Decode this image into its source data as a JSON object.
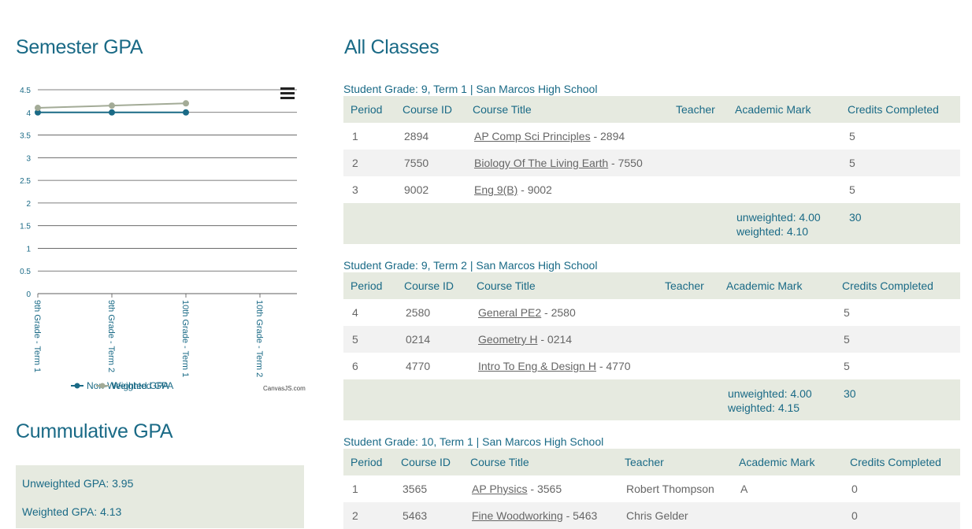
{
  "semester": {
    "title": "Semester GPA"
  },
  "cumulative": {
    "title": "Cummulative GPA",
    "unweighted": "Unweighted GPA: 3.95",
    "weighted": "Weighted GPA: 4.13"
  },
  "classes": {
    "title": "All Classes",
    "headers": [
      "Period",
      "Course ID",
      "Course Title",
      "Teacher",
      "Academic Mark",
      "Credits Completed"
    ],
    "terms": [
      {
        "label": "Student Grade: 9, Term 1 | San Marcos High School",
        "rows": [
          {
            "period": "1",
            "id": "2894",
            "title": "AP Comp Sci Principles",
            "suffix": " - 2894",
            "teacher": "",
            "mark": "",
            "credits": "5"
          },
          {
            "period": "2",
            "id": "7550",
            "title": "Biology Of The Living Earth",
            "suffix": " - 7550",
            "teacher": "",
            "mark": "",
            "credits": "5"
          },
          {
            "period": "3",
            "id": "9002",
            "title": "Eng 9(B)",
            "suffix": " - 9002",
            "teacher": "",
            "mark": "",
            "credits": "5"
          }
        ],
        "total": {
          "unweighted": "unweighted: 4.00",
          "weighted": "weighted: 4.10",
          "credits": "30"
        }
      },
      {
        "label": "Student Grade: 9, Term 2 | San Marcos High School",
        "rows": [
          {
            "period": "4",
            "id": "2580",
            "title": "General PE2",
            "suffix": " - 2580",
            "teacher": "",
            "mark": "",
            "credits": "5"
          },
          {
            "period": "5",
            "id": "0214",
            "title": "Geometry H",
            "suffix": " - 0214",
            "teacher": "",
            "mark": "",
            "credits": "5"
          },
          {
            "period": "6",
            "id": "4770",
            "title": "Intro To Eng & Design H",
            "suffix": " - 4770",
            "teacher": "",
            "mark": "",
            "credits": "5"
          }
        ],
        "total": {
          "unweighted": "unweighted: 4.00",
          "weighted": "weighted: 4.15",
          "credits": "30"
        }
      },
      {
        "label": "Student Grade: 10, Term 1 | San Marcos High School",
        "rows": [
          {
            "period": "1",
            "id": "3565",
            "title": "AP Physics",
            "suffix": " - 3565",
            "teacher": "Robert Thompson",
            "mark": "A",
            "credits": "0"
          },
          {
            "period": "2",
            "id": "5463",
            "title": "Fine Woodworking",
            "suffix": " - 5463",
            "teacher": "Chris Gelder",
            "mark": "",
            "credits": "0"
          }
        ]
      }
    ]
  },
  "chart_data": {
    "type": "line",
    "title": "",
    "xlabel": "",
    "ylabel": "",
    "categories": [
      "9th Grade - Term 1",
      "9th Grade - Term 2",
      "10th Grade - Term 1",
      "10th Grade - Term 2"
    ],
    "series": [
      {
        "name": "Non-Weighted GPA",
        "values": [
          4.0,
          4.0,
          4.0,
          null
        ],
        "color": "#1a6a86"
      },
      {
        "name": "Weighted GPA",
        "values": [
          4.1,
          4.15,
          4.2,
          null
        ],
        "color": "#a3ab97"
      }
    ],
    "ylim": [
      0,
      4.5
    ],
    "yticks": [
      "0",
      "0.5",
      "1",
      "1.5",
      "2",
      "2.5",
      "3",
      "3.5",
      "4",
      "4.5"
    ],
    "grid": true,
    "legend": "bottom",
    "credit": "CanvasJS.com"
  }
}
